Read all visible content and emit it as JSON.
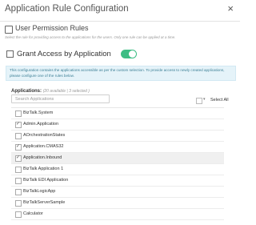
{
  "dialog": {
    "title": "Application Rule Configuration",
    "close_glyph": "×"
  },
  "section": {
    "title": "User Permission Rules",
    "description": "Select the rule for providing access to the applications for the users. Only one rule can be applied at a time."
  },
  "grant_access": {
    "label": "Grant Access by Application",
    "enabled": true
  },
  "info_banner": {
    "line1": "This configuration contains the applications accessible as per the custom selection. To provide access to newly created applications,",
    "line2": "please configure one of the rules below."
  },
  "applications": {
    "label": "Applications:",
    "counts": "(20 available | 3 selected )",
    "search_placeholder": "Search Applications",
    "select_all_label": "Select All",
    "caret_glyph": "▾",
    "check_glyph": "✓",
    "items": [
      {
        "label": "BizTalk.System",
        "checked": false,
        "selected": false
      },
      {
        "label": "Admin.Application",
        "checked": true,
        "selected": false
      },
      {
        "label": "AOrchestrationStates",
        "checked": false,
        "selected": false
      },
      {
        "label": "Application.CMAS32",
        "checked": true,
        "selected": false
      },
      {
        "label": "Application.Inbound",
        "checked": true,
        "selected": true
      },
      {
        "label": "BizTalk Application 1",
        "checked": false,
        "selected": false
      },
      {
        "label": "BizTalk EDI Application",
        "checked": false,
        "selected": false
      },
      {
        "label": "BizTalkLogicApp",
        "checked": false,
        "selected": false
      },
      {
        "label": "BizTalkServerSample",
        "checked": false,
        "selected": false
      },
      {
        "label": "Calculator",
        "checked": false,
        "selected": false
      }
    ]
  },
  "colors": {
    "toggle_on": "#3dbd84",
    "banner_bg": "#e5f3f9",
    "banner_text": "#3c7f95"
  }
}
